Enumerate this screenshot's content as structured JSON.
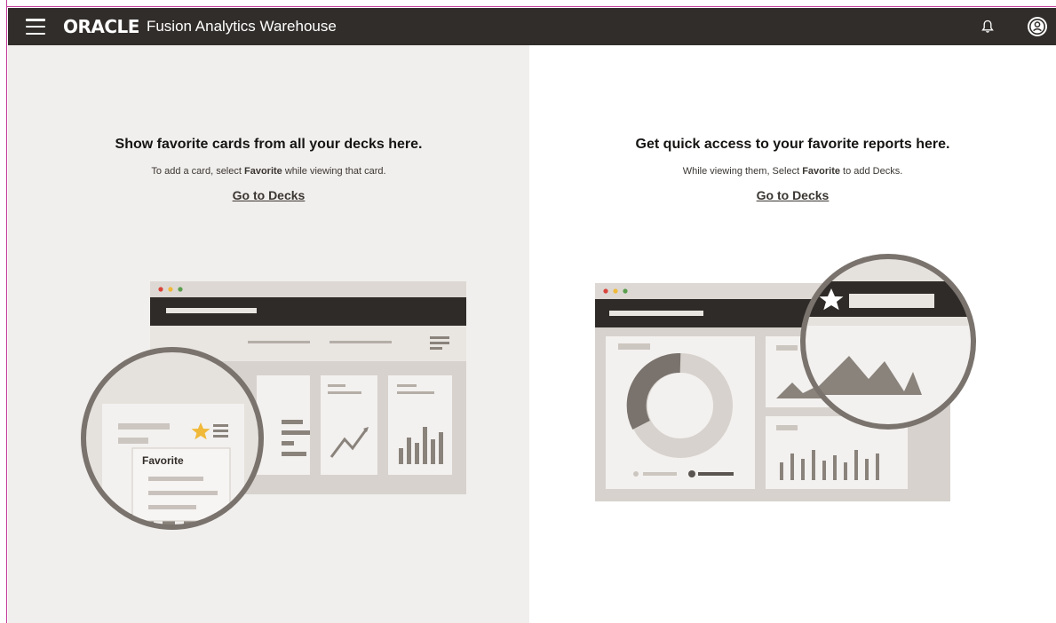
{
  "header": {
    "brand": "ORACLE",
    "product": "Fusion Analytics Warehouse"
  },
  "left": {
    "title": "Show favorite cards from all your decks here.",
    "sub_before": "To add a card, select ",
    "sub_bold": "Favorite",
    "sub_after": " while viewing that card.",
    "link": "Go to Decks",
    "popup_label": "Favorite"
  },
  "right": {
    "title": "Get quick access to your favorite reports here.",
    "sub_before": "While viewing them, Select ",
    "sub_bold": "Favorite",
    "sub_after": " to add Decks.",
    "link": "Go to Decks"
  },
  "colors": {
    "topbar": "#312d2a",
    "left_bg": "#f1efed",
    "accent_star": "#f0b93a",
    "frame": "#c2399a"
  },
  "icons": {
    "menu": "hamburger-icon",
    "bell": "bell-icon",
    "user": "user-avatar-icon"
  }
}
